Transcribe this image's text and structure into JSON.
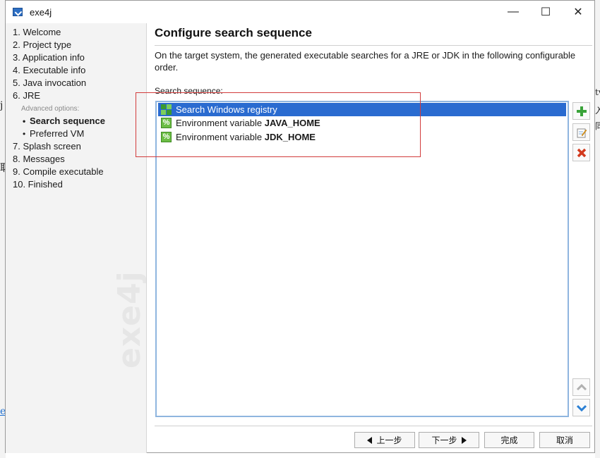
{
  "window": {
    "title": "exe4j",
    "controls": {
      "minimize": "—",
      "maximize": "☐",
      "close": "✕"
    }
  },
  "sidebar": {
    "steps": [
      {
        "label": "1. Welcome"
      },
      {
        "label": "2. Project type"
      },
      {
        "label": "3. Application info"
      },
      {
        "label": "4. Executable info"
      },
      {
        "label": "5. Java invocation"
      },
      {
        "label": "6. JRE"
      },
      {
        "label": "Advanced options:"
      },
      {
        "label": "Search sequence",
        "active": true
      },
      {
        "label": "Preferred VM"
      },
      {
        "label": "7. Splash screen"
      },
      {
        "label": "8. Messages"
      },
      {
        "label": "9. Compile executable"
      },
      {
        "label": "10. Finished"
      }
    ],
    "watermark": "exe4j"
  },
  "main": {
    "heading": "Configure search sequence",
    "description": "On the target system, the generated executable searches for a JRE or JDK in the following configurable order.",
    "list_label": "Search sequence:",
    "list_items": [
      {
        "prefix": "Search Windows registry",
        "bold": "",
        "icon": "registry-icon",
        "selected": true
      },
      {
        "prefix": "Environment variable ",
        "bold": "JAVA_HOME",
        "icon": "env-variable-icon",
        "selected": false
      },
      {
        "prefix": "Environment variable ",
        "bold": "JDK_HOME",
        "icon": "env-variable-icon",
        "selected": false
      }
    ],
    "side_buttons": {
      "add": "add-icon",
      "edit": "edit-icon",
      "remove": "remove-icon",
      "move_up": "chevron-up-icon",
      "move_down": "chevron-down-icon"
    }
  },
  "footer": {
    "back_label": "上一步",
    "next_label": "下一步",
    "finish_label": "完成",
    "cancel_label": "取消"
  },
  "background_glyphs": {
    "left_top": "j",
    "left_mid": "取",
    "left_link": "e",
    "right_1": "tv",
    "right_2": "入",
    "right_3": "同"
  },
  "colors": {
    "selection": "#2a6bd0",
    "highlight_border": "#d23c3c",
    "add_green": "#3aa33a",
    "remove_red": "#d23a1e",
    "move_down_blue": "#2a7fd4"
  }
}
